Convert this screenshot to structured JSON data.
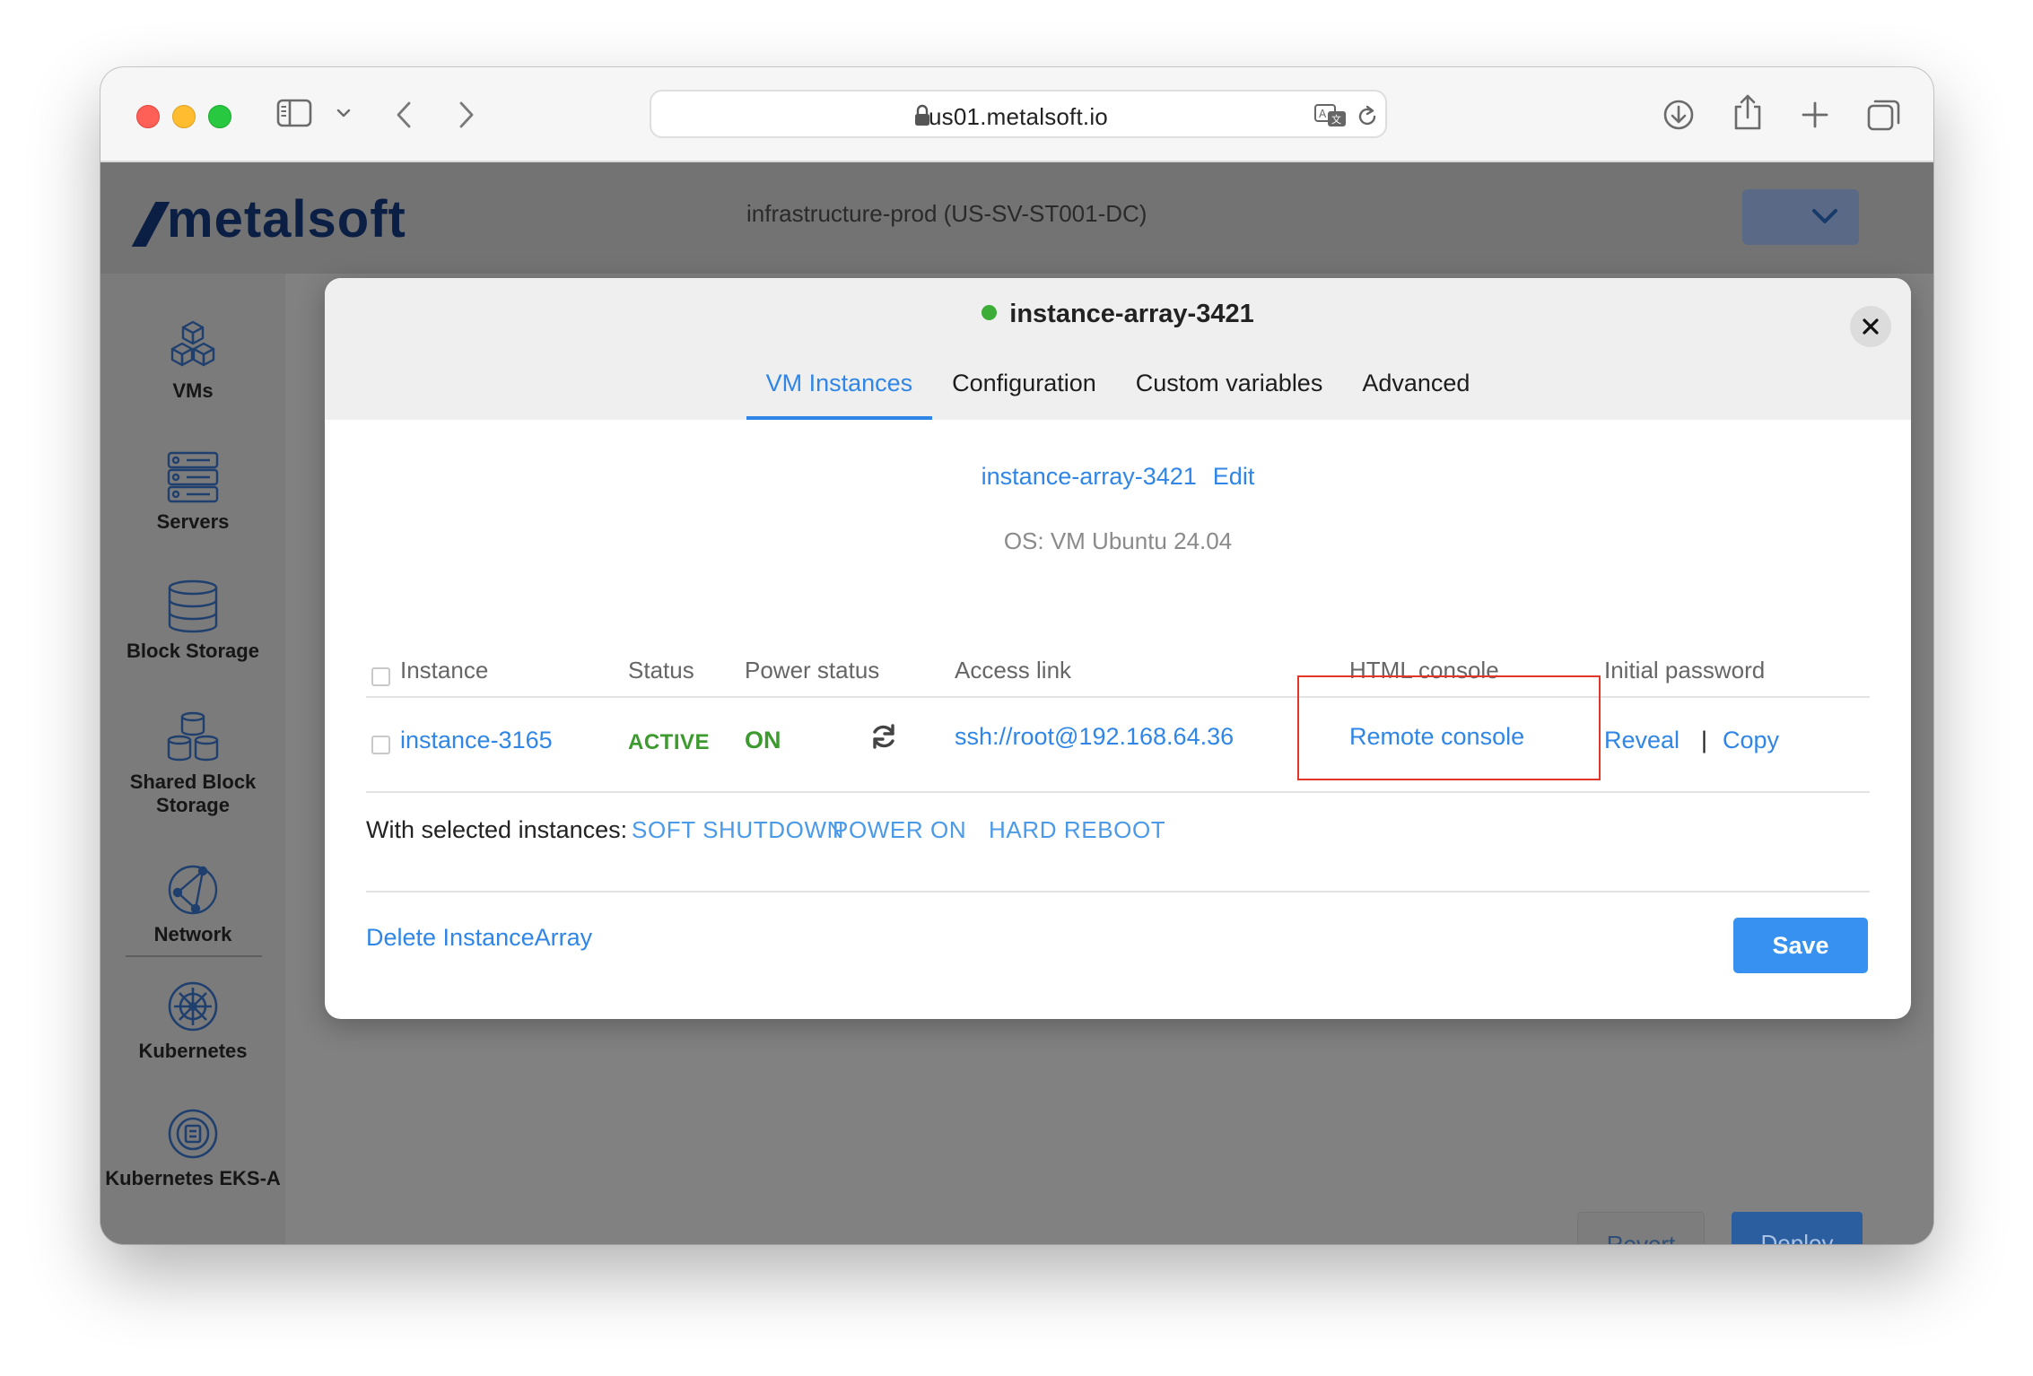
{
  "browser": {
    "url": "us01.metalsoft.io"
  },
  "app": {
    "logo_text": "metalsoft",
    "header_text": "infrastructure-prod (US-SV-ST001-DC)",
    "sidebar": [
      {
        "icon": "cubes-icon",
        "label": "VMs"
      },
      {
        "icon": "server-rack-icon",
        "label": "Servers"
      },
      {
        "icon": "database-icon",
        "label": "Block Storage"
      },
      {
        "icon": "shared-storage-icon",
        "label": "Shared Block Storage"
      },
      {
        "icon": "network-icon",
        "label": "Network"
      },
      {
        "icon": "kubernetes-icon",
        "label": "Kubernetes"
      },
      {
        "icon": "kubernetes-eksa-icon",
        "label": "Kubernetes EKS-A"
      }
    ],
    "revert_label": "Revert",
    "deploy_label": "Deploy"
  },
  "modal": {
    "title": "instance-array-3421",
    "status_color": "#3cad37",
    "tabs": [
      "VM Instances",
      "Configuration",
      "Custom variables",
      "Advanced"
    ],
    "active_tab": "VM Instances",
    "array_name": "instance-array-3421",
    "edit_label": "Edit",
    "os": "OS: VM Ubuntu 24.04",
    "columns": [
      "Instance",
      "Status",
      "Power status",
      "Access link",
      "HTML console",
      "Initial password"
    ],
    "rows": [
      {
        "instance": "instance-3165",
        "status": "ACTIVE",
        "power": "ON",
        "access_link": "ssh://root@192.168.64.36",
        "console": "Remote console",
        "reveal": "Reveal",
        "separator": "|",
        "copy": "Copy"
      }
    ],
    "selected_label": "With selected instances:",
    "bulk_actions": [
      "SOFT SHUTDOWN",
      "POWER ON",
      "HARD REBOOT"
    ],
    "delete_label": "Delete InstanceArray",
    "save_label": "Save",
    "accent_color": "#2f86e6",
    "highlight_color": "#e3362a"
  }
}
